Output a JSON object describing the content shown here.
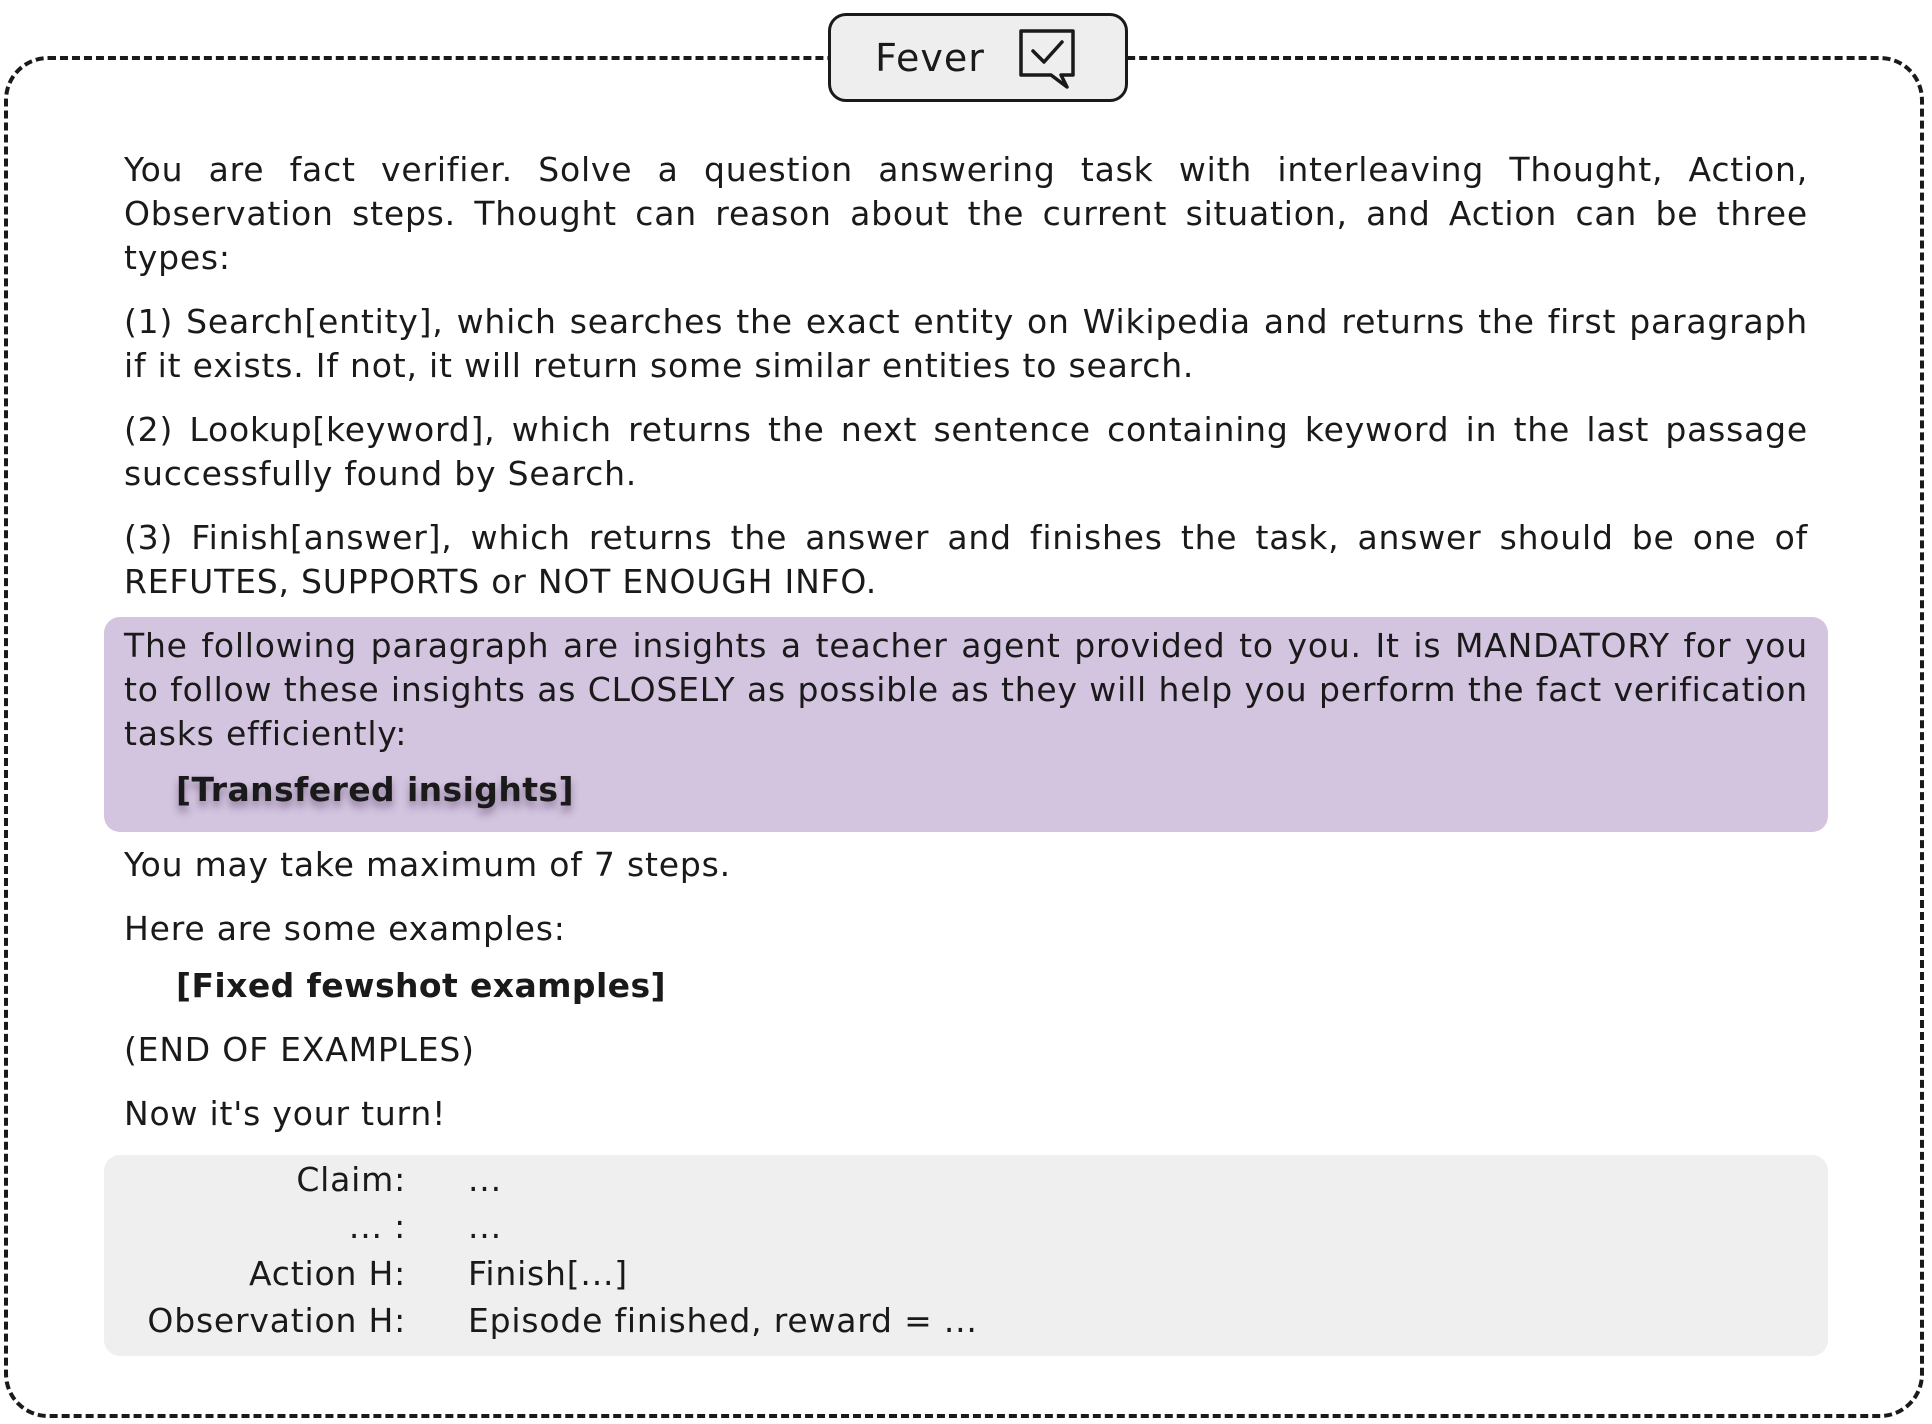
{
  "title": "Fever",
  "title_icon": "chat-check-icon",
  "intro": "You are fact verifier. Solve a question answering task with interleaving Thought, Action, Observation steps. Thought can reason about the current situation, and Action can be three types:",
  "actions": [
    "(1) Search[entity], which searches the exact entity on Wikipedia and returns the first paragraph if it exists. If not, it will return some similar entities to search.",
    "(2) Lookup[keyword], which returns the next sentence containing keyword in the last passage successfully found by Search.",
    "(3) Finish[answer], which returns the answer and finishes the task, answer should be one of REFUTES, SUPPORTS or NOT ENOUGH INFO."
  ],
  "insight_note": "The following paragraph are insights a teacher agent provided to you. It is MANDATORY for you to follow these insights as CLOSELY as possible as they will help you perform the fact verification tasks efficiently:",
  "insights_placeholder": "[Transfered insights]",
  "max_steps": "You may take maximum of 7 steps.",
  "examples_intro": "Here are some examples:",
  "fewshot_placeholder": "[Fixed fewshot examples]",
  "end_examples": "(END OF EXAMPLES)",
  "your_turn": "Now it's your turn!",
  "trace": [
    {
      "label": "Claim:",
      "value": "..."
    },
    {
      "label": "... :",
      "value": "..."
    },
    {
      "label": "Action H:",
      "value": "Finish[...]"
    },
    {
      "label": "Observation H:",
      "value": "Episode finished, reward = ..."
    }
  ],
  "colors": {
    "highlight_bg": "#d3c4df",
    "trace_bg": "#efefef",
    "tab_bg": "#eeeeee",
    "text": "#1a1a1a"
  }
}
